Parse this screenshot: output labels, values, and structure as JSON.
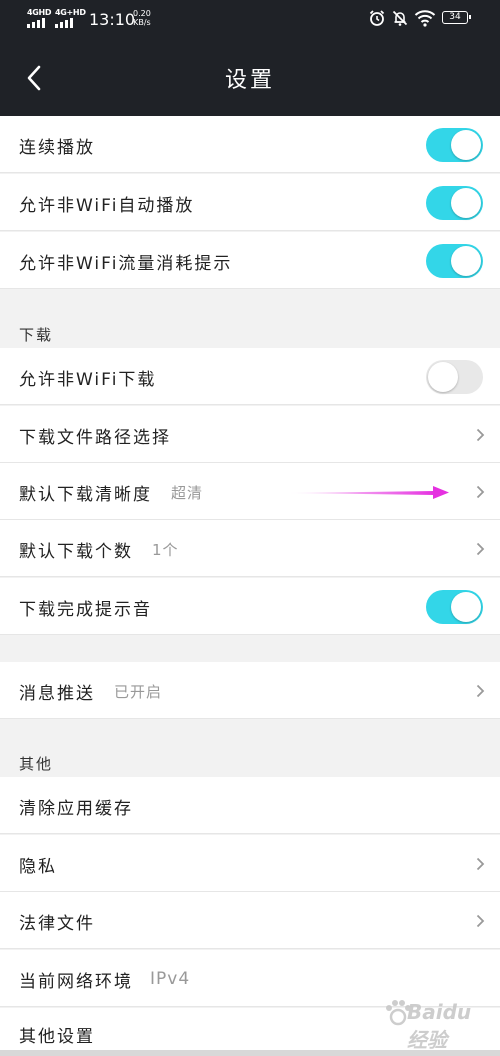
{
  "status_bar": {
    "sim1": "4GHD",
    "sim2": "4G+HD",
    "time": "13:10",
    "speed_value": "0.20",
    "speed_unit": "KB/s",
    "battery": "34",
    "icons": [
      "alarm-icon",
      "mute-icon",
      "wifi-icon",
      "battery-icon"
    ]
  },
  "header": {
    "title": "设置",
    "back_icon": "chevron-left-icon"
  },
  "rows": {
    "continuous_play": {
      "label": "连续播放",
      "toggle_on": true
    },
    "non_wifi_autoplay": {
      "label": "允许非WiFi自动播放",
      "toggle_on": true
    },
    "non_wifi_data_alert": {
      "label": "允许非WiFi流量消耗提示",
      "toggle_on": true
    },
    "non_wifi_download": {
      "label": "允许非WiFi下载",
      "toggle_on": false
    },
    "download_path": {
      "label": "下载文件路径选择"
    },
    "download_quality": {
      "label": "默认下载清晰度",
      "value": "超清"
    },
    "download_count": {
      "label": "默认下载个数",
      "value": "1个"
    },
    "download_sound": {
      "label": "下载完成提示音",
      "toggle_on": true
    },
    "push": {
      "label": "消息推送",
      "value": "已开启"
    },
    "clear_cache": {
      "label": "清除应用缓存"
    },
    "privacy": {
      "label": "隐私"
    },
    "legal": {
      "label": "法律文件"
    },
    "network_env": {
      "label": "当前网络环境",
      "value": "IPv4"
    },
    "other_settings": {
      "label": "其他设置"
    }
  },
  "sections": {
    "download": "下载",
    "other": "其他"
  },
  "watermark": {
    "text": "Baidu经验"
  },
  "colors": {
    "accent": "#33d6e8",
    "header_bg": "#1f2227",
    "annotation_arrow": "#e530e0"
  }
}
